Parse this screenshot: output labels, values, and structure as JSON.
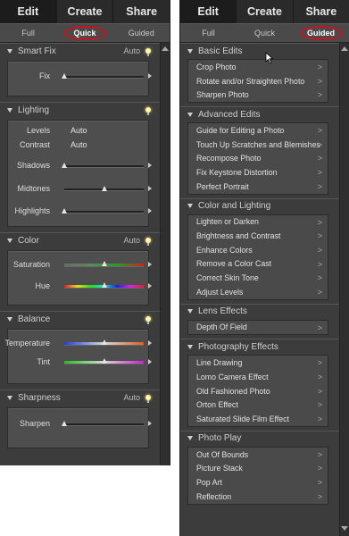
{
  "left": {
    "tabs": [
      "Edit",
      "Create",
      "Share"
    ],
    "subtabs": [
      "Full",
      "Quick",
      "Guided"
    ],
    "sections": [
      {
        "title": "Smart Fix",
        "auto": "Auto",
        "bulb": true,
        "controls": [
          {
            "label": "Fix",
            "type": "slider",
            "level": 0.0
          }
        ]
      },
      {
        "title": "Lighting",
        "auto": "",
        "bulb": true,
        "controls": [
          {
            "label": "Levels",
            "type": "value",
            "value": "Auto"
          },
          {
            "label": "Contrast",
            "type": "value",
            "value": "Auto"
          },
          {
            "label": "Shadows",
            "type": "slider",
            "level": 0.0
          },
          {
            "label": "Midtones",
            "type": "slider",
            "level": 0.5
          },
          {
            "label": "Highlights",
            "type": "slider",
            "level": 0.0
          }
        ]
      },
      {
        "title": "Color",
        "auto": "Auto",
        "bulb": true,
        "controls": [
          {
            "label": "Saturation",
            "type": "slider",
            "level": 0.5,
            "gradient": "sat"
          },
          {
            "label": "Hue",
            "type": "slider",
            "level": 0.5,
            "gradient": "hue"
          }
        ]
      },
      {
        "title": "Balance",
        "auto": "",
        "bulb": true,
        "controls": [
          {
            "label": "Temperature",
            "type": "slider",
            "level": 0.5,
            "gradient": "temp"
          },
          {
            "label": "Tint",
            "type": "slider",
            "level": 0.5,
            "gradient": "tint"
          }
        ]
      },
      {
        "title": "Sharpness",
        "auto": "Auto",
        "bulb": true,
        "controls": [
          {
            "label": "Sharpen",
            "type": "slider",
            "level": 0.0
          }
        ]
      }
    ]
  },
  "right": {
    "tabs": [
      "Edit",
      "Create",
      "Share"
    ],
    "subtabs": [
      "Full",
      "Quick",
      "Guided"
    ],
    "groups": [
      {
        "title": "Basic Edits",
        "items": [
          "Crop Photo",
          "Rotate and/or Straighten Photo",
          "Sharpen Photo"
        ]
      },
      {
        "title": "Advanced Edits",
        "items": [
          "Guide for Editing a Photo",
          "Touch Up Scratches and Blemishes",
          "Recompose Photo",
          "Fix Keystone Distortion",
          "Perfect Portrait"
        ]
      },
      {
        "title": "Color and Lighting",
        "items": [
          "Lighten or Darken",
          "Brightness and Contrast",
          "Enhance Colors",
          "Remove a Color Cast",
          "Correct Skin Tone",
          "Adjust Levels"
        ]
      },
      {
        "title": "Lens Effects",
        "items": [
          "Depth Of Field"
        ]
      },
      {
        "title": "Photography Effects",
        "items": [
          "Line Drawing",
          "Lomo Camera Effect",
          "Old Fashioned Photo",
          "Orton Effect",
          "Saturated Slide Film Effect"
        ]
      },
      {
        "title": "Photo Play",
        "items": [
          "Out Of Bounds",
          "Picture Stack",
          "Pop Art",
          "Reflection"
        ]
      }
    ],
    "chevron": ">"
  },
  "colors": {
    "panel": "#3c3c3c",
    "active_tab": "#1c1c1c",
    "highlight_circle": "#c8141e"
  }
}
